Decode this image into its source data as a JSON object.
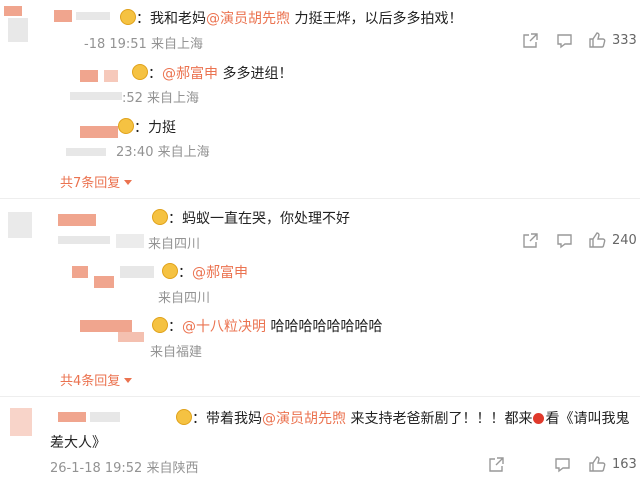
{
  "comments": [
    {
      "prefix": "：我和老妈",
      "mention": "@演员胡先煦",
      "text": " 力挺王烨，以后多多拍戏！",
      "meta": "-18 19:51 来自上海",
      "like_count": "333",
      "replies": [
        {
          "prefix": "：",
          "mention": "@郝富申",
          "text": " 多多进组！",
          "meta": ":52 来自上海"
        },
        {
          "prefix": "：力挺",
          "mention": "",
          "text": "",
          "meta": "23:40 来自上海"
        }
      ],
      "more_label": "共7条回复"
    },
    {
      "prefix": "：蚂蚁一直在哭，你处理不好",
      "mention": "",
      "text": "",
      "meta": "来自四川",
      "like_count": "240",
      "replies": [
        {
          "prefix": "：",
          "mention": "@郝富申",
          "text": "",
          "meta": "来自四川"
        },
        {
          "prefix": "：",
          "mention": "@十八粒决明",
          "text": " 哈哈哈哈哈哈哈哈",
          "meta": "来自福建"
        }
      ],
      "more_label": "共4条回复"
    },
    {
      "prefix": "：带着我妈",
      "mention": "@演员胡先煦",
      "text": " 来支持老爸新剧了！！！都来",
      "text2": "看《请叫我鬼",
      "line2": "差大人》",
      "meta": "26-1-18 19:52 来自陕西",
      "like_count": "163"
    }
  ],
  "icons": {
    "share": "share-icon",
    "comment": "comment-icon",
    "like": "thumbs-up-icon",
    "apple": "apple-emoji"
  },
  "colors": {
    "mention": "#eb7350",
    "meta": "#939393"
  }
}
